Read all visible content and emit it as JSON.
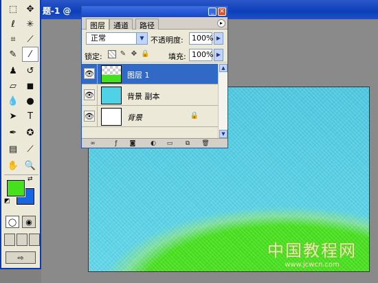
{
  "document": {
    "title": "题-1 @",
    "watermark_text": "中国教程网",
    "watermark_url": "www.jcwcn.com"
  },
  "toolbox": {
    "tools": [
      {
        "icon": "marquee-icon",
        "glyph": "⬚"
      },
      {
        "icon": "move-icon",
        "glyph": "✥"
      },
      {
        "icon": "lasso-icon",
        "glyph": "ℓ"
      },
      {
        "icon": "magic-wand-icon",
        "glyph": "✳"
      },
      {
        "icon": "crop-icon",
        "glyph": "⌗"
      },
      {
        "icon": "slice-icon",
        "glyph": "⟋"
      },
      {
        "icon": "healing-brush-icon",
        "glyph": "✎"
      },
      {
        "icon": "brush-icon",
        "glyph": "⁄"
      },
      {
        "icon": "clone-stamp-icon",
        "glyph": "♟"
      },
      {
        "icon": "history-brush-icon",
        "glyph": "↺"
      },
      {
        "icon": "eraser-icon",
        "glyph": "▱"
      },
      {
        "icon": "gradient-icon",
        "glyph": "◼"
      },
      {
        "icon": "blur-icon",
        "glyph": "💧"
      },
      {
        "icon": "dodge-icon",
        "glyph": "●"
      },
      {
        "icon": "path-select-icon",
        "glyph": "➤"
      },
      {
        "icon": "type-icon",
        "glyph": "T"
      },
      {
        "icon": "pen-icon",
        "glyph": "✒"
      },
      {
        "icon": "shape-icon",
        "glyph": "✪"
      },
      {
        "icon": "notes-icon",
        "glyph": "▤"
      },
      {
        "icon": "eyedropper-icon",
        "glyph": "⟋"
      },
      {
        "icon": "hand-icon",
        "glyph": "✋"
      },
      {
        "icon": "zoom-icon",
        "glyph": "🔍"
      }
    ],
    "foreground_color": "#47e01c",
    "background_color": "#1566e0"
  },
  "layers_panel": {
    "tabs": [
      "图层",
      "通道",
      "路径"
    ],
    "blend_mode": "正常",
    "opacity_label": "不透明度:",
    "opacity_value": "100%",
    "lock_label": "锁定:",
    "fill_label": "填充:",
    "fill_value": "100%",
    "layers": [
      {
        "name": "图层 1",
        "selected": true,
        "thumb": "green-transparent"
      },
      {
        "name": "背景 副本",
        "selected": false,
        "thumb": "cyan"
      },
      {
        "name": "背景",
        "selected": false,
        "thumb": "white",
        "italic": true,
        "locked": true
      }
    ],
    "footer_icons": [
      "link-icon",
      "layer-style-icon",
      "mask-icon",
      "adjustment-icon",
      "folder-icon",
      "new-layer-icon",
      "trash-icon"
    ]
  },
  "colors": {
    "titlebar_blue": "#0b3fb9",
    "selection_blue": "#3169c6",
    "sky_cyan": "#5fd6e8",
    "grass_green": "#48e01e"
  }
}
